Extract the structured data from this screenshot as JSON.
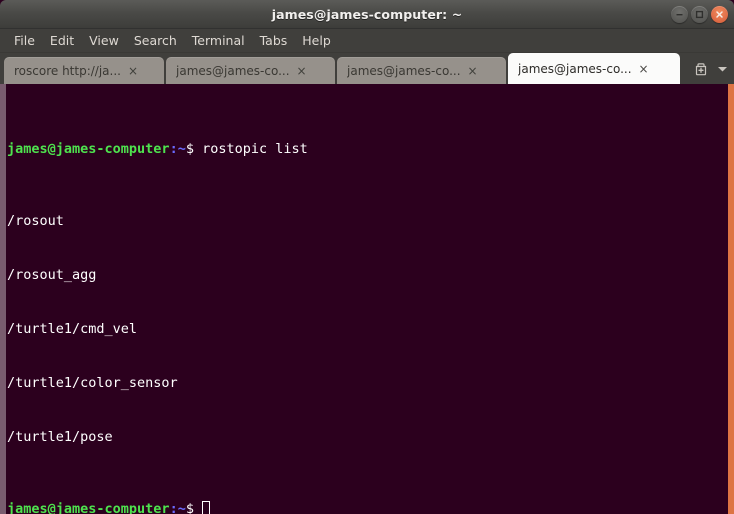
{
  "window": {
    "title": "james@james-computer: ~",
    "controls": [
      {
        "name": "minimize",
        "glyph": "minimize-icon"
      },
      {
        "name": "maximize",
        "glyph": "maximize-icon"
      },
      {
        "name": "close",
        "glyph": "close-icon"
      }
    ],
    "close_color": "#e2704a",
    "titlebar_color": "#4a4a47",
    "border_accent": "#dd7444"
  },
  "menubar": {
    "items": [
      {
        "label": "File"
      },
      {
        "label": "Edit"
      },
      {
        "label": "View"
      },
      {
        "label": "Search"
      },
      {
        "label": "Terminal"
      },
      {
        "label": "Tabs"
      },
      {
        "label": "Help"
      }
    ]
  },
  "tabbar": {
    "tabs": [
      {
        "label": "roscore http://ja...",
        "close": "×",
        "active": false
      },
      {
        "label": "james@james-co...",
        "close": "×",
        "active": false
      },
      {
        "label": "james@james-co...",
        "close": "×",
        "active": false
      },
      {
        "label": "james@james-co...",
        "close": "×",
        "active": true
      }
    ],
    "new_tab_icon": "new-tab-icon",
    "dropdown_icon": "chevron-down-icon"
  },
  "terminal": {
    "background": "#2c001e",
    "foreground": "#ffffff",
    "prompt_color": "#4ee24e",
    "path_color": "#6a6aff",
    "lines": [
      {
        "type": "prompt",
        "user_host": "james@james-computer",
        "sep": ":",
        "path": "~",
        "dollar": "$ ",
        "command": "rostopic list"
      },
      {
        "type": "output",
        "text": "/rosout"
      },
      {
        "type": "output",
        "text": "/rosout_agg"
      },
      {
        "type": "output",
        "text": "/turtle1/cmd_vel"
      },
      {
        "type": "output",
        "text": "/turtle1/color_sensor"
      },
      {
        "type": "output",
        "text": "/turtle1/pose"
      },
      {
        "type": "prompt_cursor",
        "user_host": "james@james-computer",
        "sep": ":",
        "path": "~",
        "dollar": "$ ",
        "command": ""
      }
    ]
  }
}
